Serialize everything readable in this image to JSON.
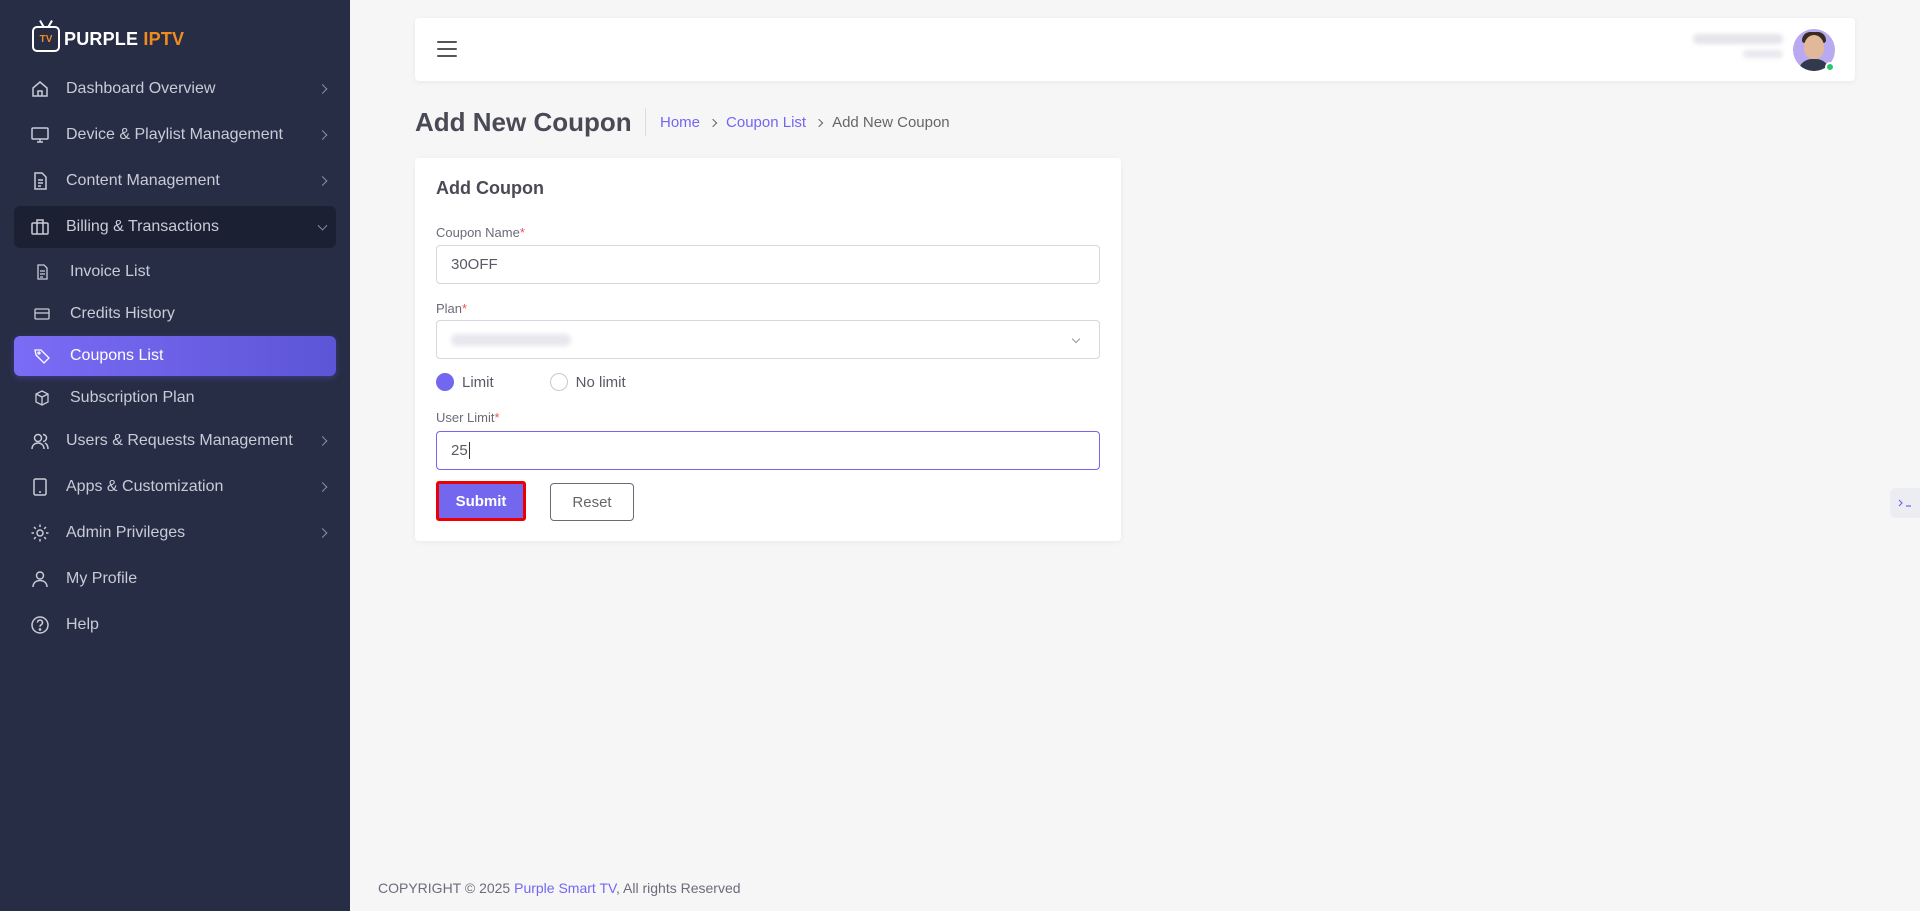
{
  "brand": {
    "icon_text": "TV",
    "name_part1": "PURPLE",
    "name_part2": "IPTV"
  },
  "sidebar": {
    "items": [
      {
        "label": "Dashboard Overview",
        "icon": "home-icon"
      },
      {
        "label": "Device & Playlist Management",
        "icon": "monitor-icon"
      },
      {
        "label": "Content Management",
        "icon": "document-icon"
      },
      {
        "label": "Billing & Transactions",
        "icon": "briefcase-icon"
      },
      {
        "label": "Users & Requests Management",
        "icon": "users-icon"
      },
      {
        "label": "Apps & Customization",
        "icon": "tablet-icon"
      },
      {
        "label": "Admin Privileges",
        "icon": "gear-icon"
      },
      {
        "label": "My Profile",
        "icon": "user-icon"
      },
      {
        "label": "Help",
        "icon": "help-icon"
      }
    ],
    "sub_items": [
      {
        "label": "Invoice List",
        "icon": "file-icon"
      },
      {
        "label": "Credits History",
        "icon": "credit-card-icon"
      },
      {
        "label": "Coupons List",
        "icon": "tag-icon"
      },
      {
        "label": "Subscription Plan",
        "icon": "box-icon"
      }
    ],
    "open_item": "Billing & Transactions",
    "active_sub_item": "Coupons List"
  },
  "page": {
    "title": "Add New Coupon",
    "breadcrumb": {
      "home": "Home",
      "list": "Coupon List",
      "current": "Add New Coupon"
    }
  },
  "form": {
    "card_title": "Add Coupon",
    "coupon_name_label": "Coupon Name",
    "coupon_name_value": "30OFF",
    "plan_label": "Plan",
    "required_mark": "*",
    "limit_option": "Limit",
    "no_limit_option": "No limit",
    "selected_limit": "Limit",
    "user_limit_label": "User Limit",
    "user_limit_value": "25",
    "submit_label": "Submit",
    "reset_label": "Reset"
  },
  "footer": {
    "prefix": "COPYRIGHT © 2025 ",
    "link": "Purple Smart TV",
    "suffix": ", All rights Reserved"
  },
  "colors": {
    "sidebar_bg": "#282d46",
    "accent": "#7367f0",
    "brand_orange": "#f28b1f",
    "highlight_border": "#e00000"
  }
}
